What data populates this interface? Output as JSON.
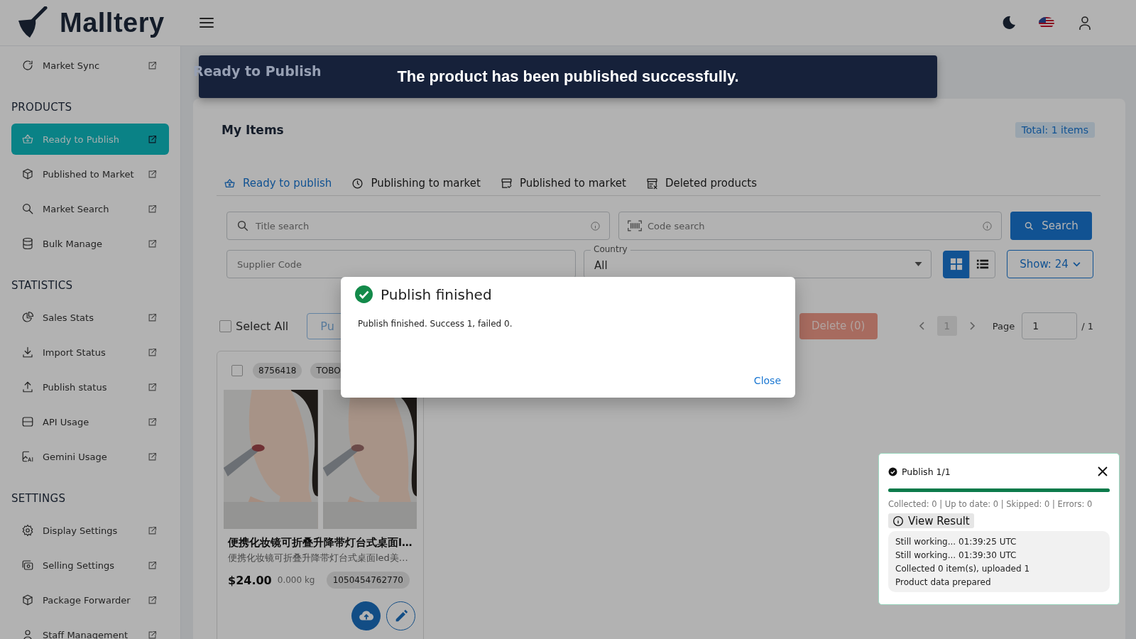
{
  "brand": {
    "name": "Malltery"
  },
  "sidebar": {
    "sections": [
      {
        "items": [
          {
            "label": "Market Sync",
            "selected": false
          }
        ]
      },
      {
        "title": "PRODUCTS",
        "items": [
          {
            "label": "Ready to Publish",
            "selected": true
          },
          {
            "label": "Published to Market",
            "selected": false
          },
          {
            "label": "Market Search",
            "selected": false
          },
          {
            "label": "Bulk Manage",
            "selected": false
          }
        ]
      },
      {
        "title": "STATISTICS",
        "items": [
          {
            "label": "Sales Stats",
            "selected": false
          },
          {
            "label": "Import Status",
            "selected": false
          },
          {
            "label": "Publish status",
            "selected": false
          },
          {
            "label": "API Usage",
            "selected": false
          },
          {
            "label": "Gemini Usage",
            "selected": false
          }
        ]
      },
      {
        "title": "SETTINGS",
        "items": [
          {
            "label": "Display Settings",
            "selected": false
          },
          {
            "label": "Selling Settings",
            "selected": false
          },
          {
            "label": "Package Forwarder",
            "selected": false
          },
          {
            "label": "Staff Management",
            "selected": false
          }
        ]
      }
    ]
  },
  "page": {
    "title": "Ready to Publish"
  },
  "panel": {
    "title": "My Items",
    "total": "Total: 1 items",
    "tabs": [
      {
        "label": "Ready to publish",
        "selected": true
      },
      {
        "label": "Publishing to market",
        "selected": false
      },
      {
        "label": "Published to market",
        "selected": false
      },
      {
        "label": "Deleted products",
        "selected": false
      }
    ],
    "title_search": {
      "placeholder": "Title search"
    },
    "code_search": {
      "placeholder": "Code search"
    },
    "search_button": "Search",
    "supplier_code": {
      "placeholder": "Supplier Code"
    },
    "country": {
      "label": "Country",
      "value": "All"
    },
    "views": [
      {
        "kind": "grid",
        "selected": true
      },
      {
        "kind": "list",
        "selected": false
      }
    ],
    "show_button": "Show: 24",
    "select_all": {
      "label": "Select All",
      "checked": false
    },
    "publish_button": "Pu",
    "delete_button": {
      "label": "Delete (0)",
      "disabled": true
    },
    "pages": [
      {
        "label": "1",
        "selected": true
      }
    ],
    "page_label": "Page",
    "page_input": "1",
    "page_total": "/ 1"
  },
  "products": [
    {
      "checked": false,
      "chips": [
        "8756418",
        "TOBO"
      ],
      "title": "便携化妆镜可折叠升降带灯台式桌面l…",
      "subtitle": "便携化妆镜可折叠升降带灯台式桌面led美…",
      "price": "$24.00",
      "weight": "0.000 kg",
      "code": "1050454762770"
    }
  ],
  "toast": {
    "message": "The product has been published successfully."
  },
  "dialog": {
    "title": "Publish finished",
    "message": "Publish finished. Success 1, failed 0.",
    "close": "Close"
  },
  "progress": {
    "title": "Publish 1/1",
    "level": 1,
    "stats": "Collected: 0 | Up to date: 0 | Skipped: 0 | Errors: 0",
    "view_result": "View Result",
    "log": [
      "Still working... 01:39:25 UTC",
      "Still working... 01:39:30 UTC",
      "Collected 0 item(s), uploaded 1",
      "Product data prepared"
    ]
  }
}
